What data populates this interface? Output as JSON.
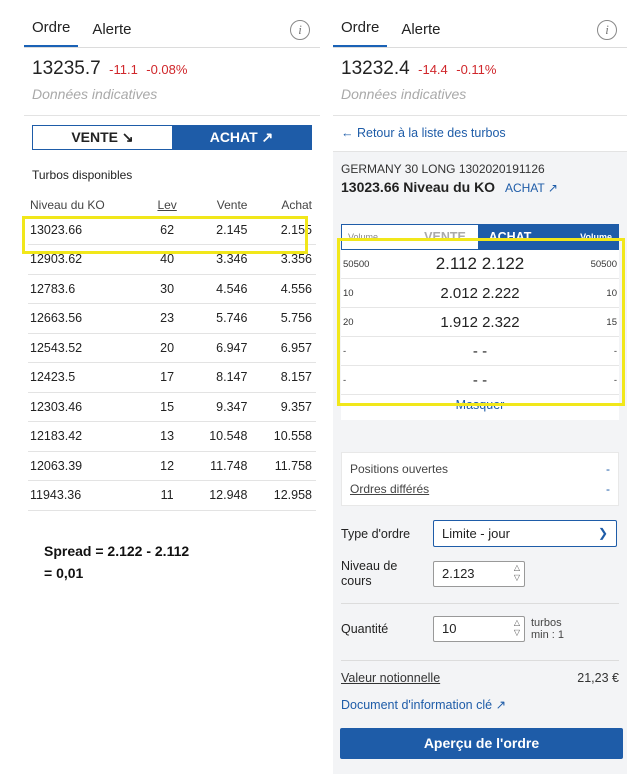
{
  "left": {
    "tabs": [
      "Ordre",
      "Alerte"
    ],
    "price": "13235.7",
    "change": "-11.1",
    "change_pct": "-0.08%",
    "indicative": "Données indicatives",
    "toggle": {
      "vente": "VENTE ↘",
      "achat": "ACHAT ↗"
    },
    "turbos_label": "Turbos disponibles",
    "columns": [
      "Niveau du KO",
      "Lev",
      "Vente",
      "Achat"
    ],
    "rows": [
      [
        "13023.66",
        "62",
        "2.145",
        "2.155"
      ],
      [
        "12903.62",
        "40",
        "3.346",
        "3.356"
      ],
      [
        "12783.6",
        "30",
        "4.546",
        "4.556"
      ],
      [
        "12663.56",
        "23",
        "5.746",
        "5.756"
      ],
      [
        "12543.52",
        "20",
        "6.947",
        "6.957"
      ],
      [
        "12423.5",
        "17",
        "8.147",
        "8.157"
      ],
      [
        "12303.46",
        "15",
        "9.347",
        "9.357"
      ],
      [
        "12183.42",
        "13",
        "10.548",
        "10.558"
      ],
      [
        "12063.39",
        "12",
        "11.748",
        "11.758"
      ],
      [
        "11943.36",
        "11",
        "12.948",
        "12.958"
      ]
    ]
  },
  "annotation": {
    "line1": "Spread = 2.122 - 2.112",
    "line2": "= 0,01"
  },
  "right": {
    "tabs": [
      "Ordre",
      "Alerte"
    ],
    "price": "13232.4",
    "change": "-14.4",
    "change_pct": "-0.11%",
    "indicative": "Données indicatives",
    "back_link": "← Retour à la liste des turbos",
    "product_name": "GERMANY 30 LONG 1302020191126",
    "ko_level": "13023.66 Niveau du KO",
    "achat_link": "ACHAT ↗",
    "book_header": {
      "vol1": "Volume",
      "vente": "VENTE",
      "achat": "ACHAT",
      "vol2": "Volume"
    },
    "book_rows": [
      {
        "v1": "50500",
        "px": "2.112 2.122",
        "v2": "50500"
      },
      {
        "v1": "10",
        "px": "2.012 2.222",
        "v2": "10"
      },
      {
        "v1": "20",
        "px": "1.912 2.322",
        "v2": "15"
      },
      {
        "v1": "-",
        "px": "- -",
        "v2": "-"
      },
      {
        "v1": "-",
        "px": "- -",
        "v2": "-"
      }
    ],
    "masquer": "Masquer",
    "positions_ouvertes": "Positions ouvertes",
    "ordres_differes": "Ordres différés",
    "dash": "-",
    "type_ordre_label": "Type d'ordre",
    "type_ordre_value": "Limite - jour",
    "niveau_label": "Niveau de cours",
    "niveau_value": "2.123",
    "quantite_label": "Quantité",
    "quantite_value": "10",
    "quantite_unit": "turbos min : 1",
    "valeur_label": "Valeur notionnelle",
    "valeur_value": "21,23 €",
    "document_link": "Document d'information clé",
    "apercu_button": "Aperçu de l'ordre"
  }
}
